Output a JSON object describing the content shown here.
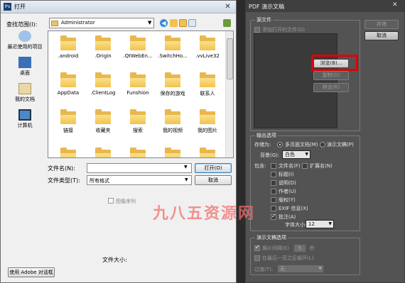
{
  "open_dialog": {
    "title": "打开",
    "app_badge": "Ps",
    "lookin_label": "查找范围(I):",
    "lookin_value": "Administrator",
    "places": [
      "最近使用的项目",
      "桌面",
      "我的文档",
      "计算机"
    ],
    "files": [
      ".android",
      ".Origin",
      ".QtWebEn...",
      ".SwitchHo...",
      ".vvLive32",
      "AppData",
      ".ClientLog",
      "Funshion",
      "保存的游戏",
      "联系人",
      "链接",
      "收藏夹",
      "搜索",
      "我的视频",
      "我的图片"
    ],
    "filename_label": "文件名(N):",
    "filename_value": "",
    "filetype_label": "文件类型(T):",
    "filetype_value": "所有格式",
    "open_button": "打开(O)",
    "cancel_button": "取消",
    "image_sequence_label": "图像序列",
    "filesize_label": "文件大小:",
    "adobe_dialog_button": "使用 Adobe 对话框"
  },
  "pdf_dialog": {
    "title": "PDF 演示文稿",
    "close_glyph": "✕",
    "source_group": "源文件",
    "add_open_files_label": "添加打开的文件(O)",
    "browse_button": "浏览(B)...",
    "duplicate_button": "复制(D)",
    "remove_button": "移去(R)",
    "save_button": "存储",
    "cancel_button": "取消",
    "output_group": "输出选项",
    "save_as_label": "存储为:",
    "multipage_label": "多页面文档(M)",
    "presentation_label": "演示文稿(P)",
    "background_label": "背景(G):",
    "background_value": "白色",
    "include_label": "包含:",
    "include_options": [
      {
        "label": "文件名(F)",
        "checked": false
      },
      {
        "label": "扩展名(N)",
        "checked": false
      },
      {
        "label": "标题(I)",
        "checked": false
      },
      {
        "label": "说明(D)",
        "checked": false
      },
      {
        "label": "作者(U)",
        "checked": false
      },
      {
        "label": "版权(Y)",
        "checked": false
      },
      {
        "label": "EXIF 信息(X)",
        "checked": false
      },
      {
        "label": "批注(A)",
        "checked": true
      }
    ],
    "font_size_label": "字体大小(S):",
    "font_size_value": "12",
    "presentation_group": "演示文稿选项",
    "advance_label": "换片间隔(E)",
    "advance_value": "5",
    "seconds_label": "秒",
    "loop_label": "在最后一页之后循环(L)",
    "transition_label": "过渡(T):",
    "transition_value": "无"
  },
  "watermark_text": "九八五资源网",
  "colors": {
    "highlight": "#e10000",
    "folder": "#f2c24f",
    "pdf_panel": "#535353"
  }
}
